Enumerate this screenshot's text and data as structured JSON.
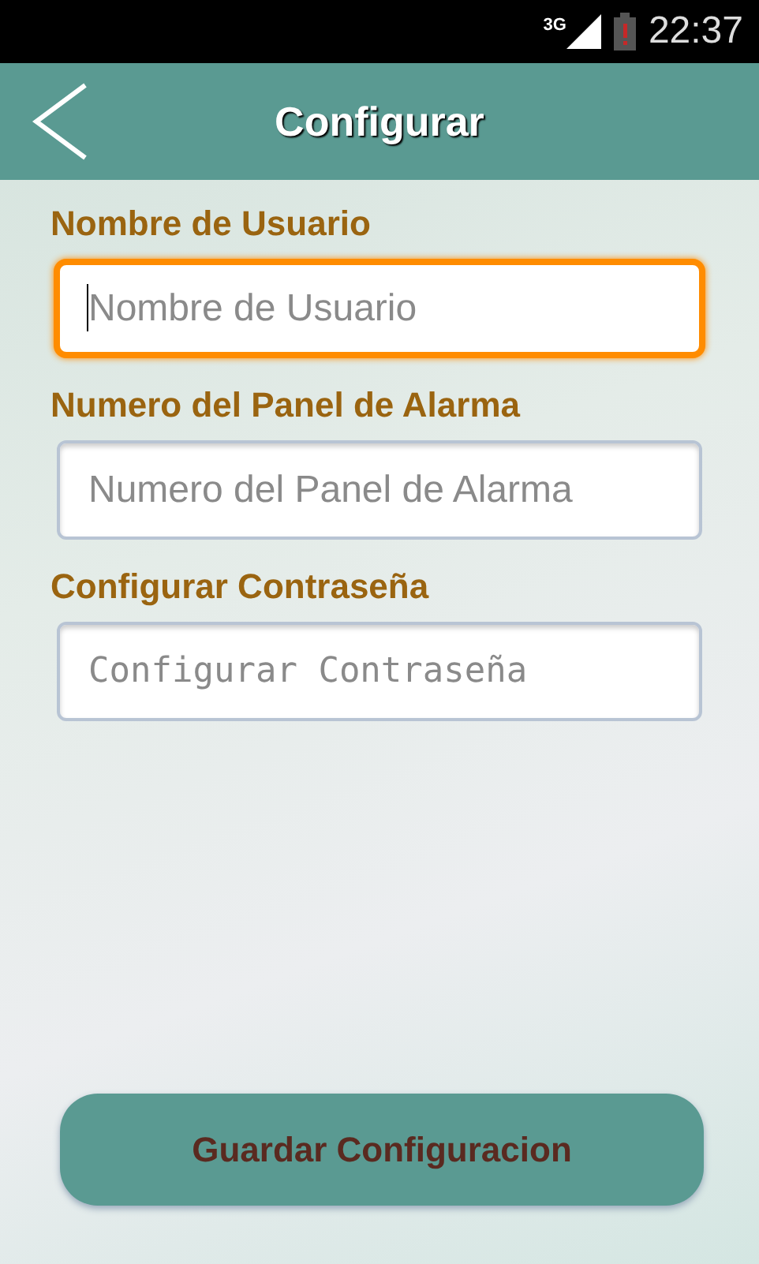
{
  "status_bar": {
    "network": "3G",
    "time": "22:37"
  },
  "header": {
    "title": "Configurar"
  },
  "fields": [
    {
      "label": "Nombre de Usuario",
      "placeholder": "Nombre de Usuario",
      "kind": "text",
      "focused": true
    },
    {
      "label": "Numero del Panel de Alarma",
      "placeholder": "Numero del Panel de Alarma",
      "kind": "text",
      "focused": false
    },
    {
      "label": "Configurar Contraseña",
      "placeholder": "Configurar Contraseña",
      "kind": "password",
      "focused": false
    }
  ],
  "save_button": {
    "label": "Guardar Configuracion"
  }
}
